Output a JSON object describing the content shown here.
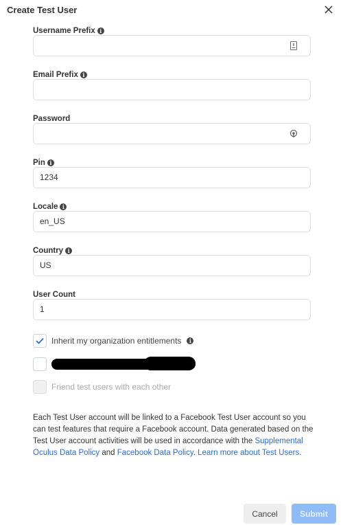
{
  "dialog": {
    "title": "Create Test User",
    "close_icon": "close-icon"
  },
  "fields": [
    {
      "label": "Username Prefix",
      "info": true,
      "value": "",
      "icon": "contact-card-icon"
    },
    {
      "label": "Email Prefix",
      "info": true,
      "value": ""
    },
    {
      "label": "Password",
      "info": false,
      "value": "",
      "icon": "password-key-icon"
    },
    {
      "label": "Pin",
      "info": true,
      "value": "1234"
    },
    {
      "label": "Locale",
      "info": true,
      "value": "en_US"
    },
    {
      "label": "Country",
      "info": true,
      "value": "US"
    },
    {
      "label": "User Count",
      "info": false,
      "value": "1"
    }
  ],
  "checkboxes": [
    {
      "label": "Inherit my organization entitlements",
      "checked": true,
      "disabled": false,
      "info": true
    },
    {
      "label": null,
      "checked": false,
      "disabled": false,
      "redacted": true
    },
    {
      "label": "Friend test users with each other",
      "checked": false,
      "disabled": true
    }
  ],
  "notice": {
    "text1": "Each Test User account will be linked to a Facebook Test User account so you can test features that require a Facebook account. Data generated based on the Test User account activities will be used in accordance with the ",
    "link1": "Supplemental Oculus Data Policy",
    "text2": " and ",
    "link2": "Facebook Data Policy",
    "text3": ". ",
    "link3": "Learn more about Test Users."
  },
  "buttons": {
    "cancel": "Cancel",
    "submit": "Submit"
  },
  "colors": {
    "accent": "#2d6bc4",
    "submit_disabled": "#8fbcf6",
    "check": "#2d6bc4"
  }
}
